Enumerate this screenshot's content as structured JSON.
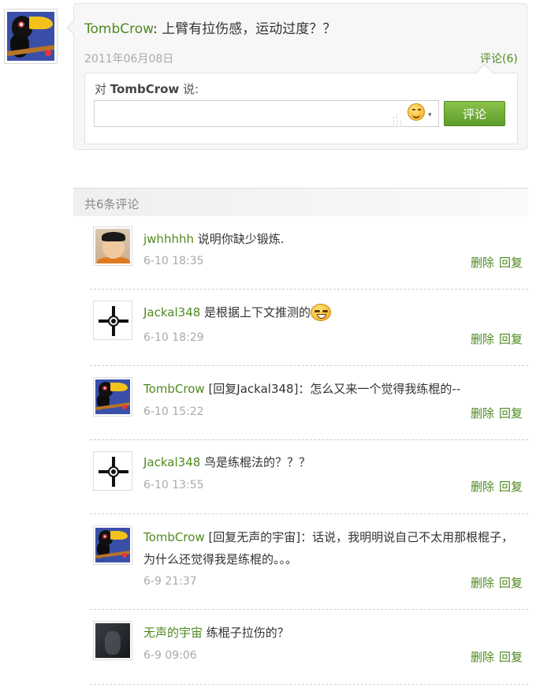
{
  "post": {
    "author": "TombCrow",
    "text": ": 上臂有拉伤感，运动过度？？",
    "date": "2011年06月08日",
    "comment_link": "评论(6)"
  },
  "reply": {
    "prefix": "对 ",
    "target": "TombCrow",
    "suffix": " 说:",
    "input_value": "",
    "submit_label": "评论"
  },
  "comments_header": "共6条评论",
  "comments": [
    {
      "user": "jwhhhhh",
      "text": " 说明你缺少锻炼.",
      "time": "6-10 18:35",
      "delete_label": "删除",
      "reply_label": "回复"
    },
    {
      "user": "Jackal348",
      "text": " 是根据上下文推测的",
      "time": "6-10 18:29",
      "delete_label": "删除",
      "reply_label": "回复"
    },
    {
      "user": "TombCrow",
      "text": " [回复Jackal348]：怎么又来一个觉得我练棍的--",
      "time": "6-10 15:22",
      "delete_label": "删除",
      "reply_label": "回复"
    },
    {
      "user": "Jackal348",
      "text": " 鸟是练棍法的？？？",
      "time": "6-10 13:55",
      "delete_label": "删除",
      "reply_label": "回复"
    },
    {
      "user": "TombCrow",
      "text": " [回复无声的宇宙]：话说，我明明说自己不太用那根棍子，",
      "text2": "为什么还觉得我是练棍的。。。",
      "time": "6-9 21:37",
      "delete_label": "删除",
      "reply_label": "回复"
    },
    {
      "user": "无声的宇宙",
      "text": " 练棍子拉伤的？",
      "time": "6-9 09:06",
      "delete_label": "删除",
      "reply_label": "回复"
    }
  ]
}
